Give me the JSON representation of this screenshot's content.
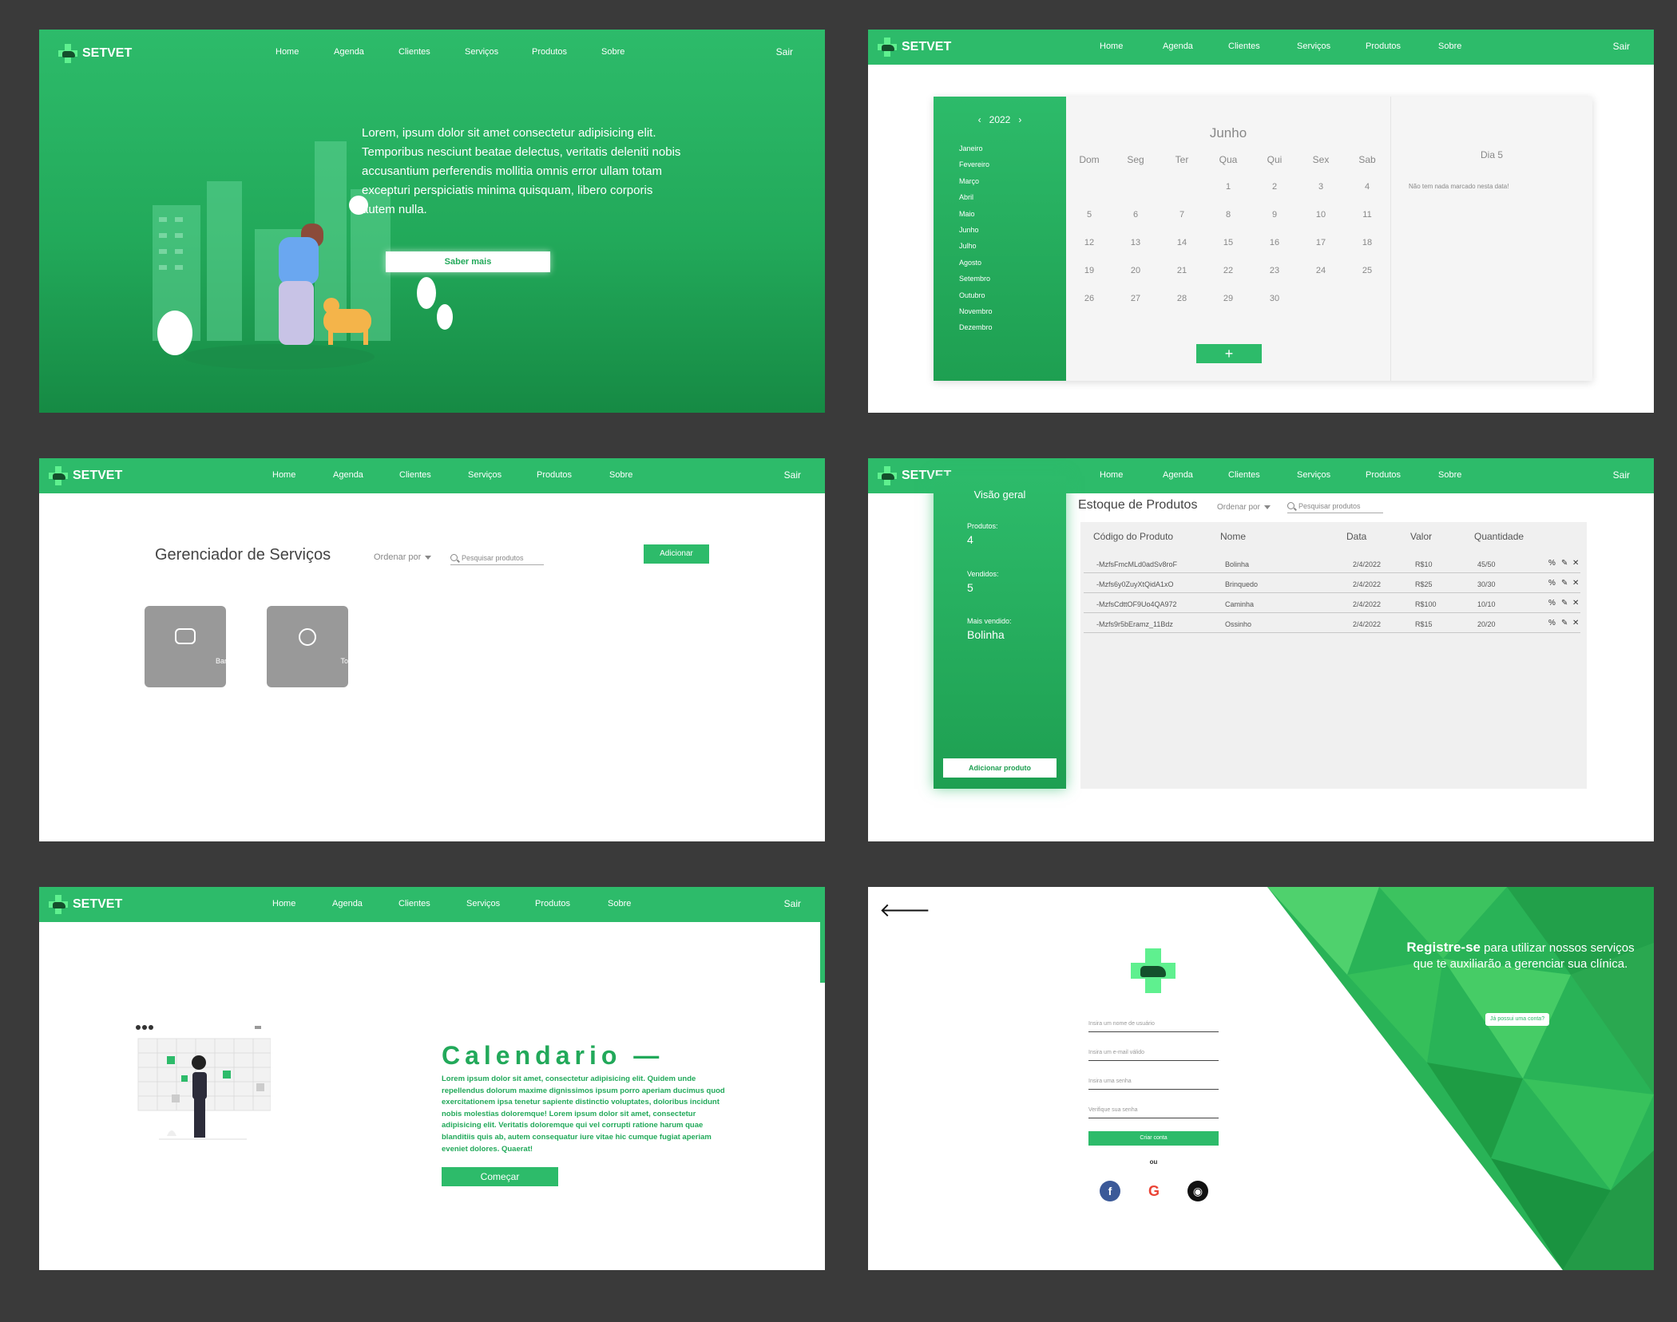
{
  "nav": {
    "brand": "SETVET",
    "links": [
      "Home",
      "Agenda",
      "Clientes",
      "Serviços",
      "Produtos",
      "Sobre"
    ],
    "logout": "Sair"
  },
  "home": {
    "hero_text": "Lorem, ipsum dolor sit amet consectetur adipisicing elit. Temporibus nesciunt beatae delectus, veritatis deleniti nobis accusantium perferendis mollitia omnis error ullam totam excepturi perspiciatis minima quisquam, libero corporis autem nulla.",
    "cta": "Saber mais"
  },
  "agenda": {
    "year": "2022",
    "months": [
      "Janeiro",
      "Fevereiro",
      "Março",
      "Abril",
      "Maio",
      "Junho",
      "Julho",
      "Agosto",
      "Setembro",
      "Outubro",
      "Novembro",
      "Dezembro"
    ],
    "current_month": "Junho",
    "weekdays": [
      "Dom",
      "Seg",
      "Ter",
      "Qua",
      "Qui",
      "Sex",
      "Sab"
    ],
    "days": [
      "",
      "",
      "",
      "1",
      "2",
      "3",
      "4",
      "5",
      "6",
      "7",
      "8",
      "9",
      "10",
      "11",
      "12",
      "13",
      "14",
      "15",
      "16",
      "17",
      "18",
      "19",
      "20",
      "21",
      "22",
      "23",
      "24",
      "25",
      "26",
      "27",
      "28",
      "29",
      "30"
    ],
    "add_label": "+",
    "selected_day": "Dia 5",
    "empty_message": "Não tem nada marcado nesta data!"
  },
  "services": {
    "title": "Gerenciador de Serviços",
    "sort_label": "Ordenar por",
    "search_placeholder": "Pesquisar produtos",
    "add_label": "Adicionar",
    "cards": [
      {
        "label": "Banho"
      },
      {
        "label": "Tosa"
      }
    ]
  },
  "products": {
    "overview_title": "Visão geral",
    "stats": [
      {
        "label": "Produtos:",
        "value": "4"
      },
      {
        "label": "Vendidos:",
        "value": "5"
      },
      {
        "label": "Mais vendido:",
        "value": "Bolinha"
      }
    ],
    "add_product": "Adicionar produto",
    "title": "Estoque de Produtos",
    "sort_label": "Ordenar por",
    "search_placeholder": "Pesquisar produtos",
    "columns": [
      "Código do Produto",
      "Nome",
      "Data",
      "Valor",
      "Quantidade"
    ],
    "rows": [
      {
        "code": "-MzfsFmcMLd0adSv8roF",
        "name": "Bolinha",
        "date": "2/4/2022",
        "price": "R$10",
        "qty": "45/50"
      },
      {
        "code": "-Mzfs6y0ZuyXtQidA1xO",
        "name": "Brinquedo",
        "date": "2/4/2022",
        "price": "R$25",
        "qty": "30/30"
      },
      {
        "code": "-MzfsCdttOF9Uo4QA972",
        "name": "Caminha",
        "date": "2/4/2022",
        "price": "R$100",
        "qty": "10/10"
      },
      {
        "code": "-Mzfs9r5bEramz_11Bdz",
        "name": "Ossinho",
        "date": "2/4/2022",
        "price": "R$15",
        "qty": "20/20"
      }
    ]
  },
  "calendar_intro": {
    "heading": "Calendario —",
    "body": "Lorem ipsum dolor sit amet, consectetur adipisicing elit. Quidem unde repellendus dolorum maxime dignissimos ipsum porro aperiam ducimus quod exercitationem ipsa tenetur sapiente distinctio voluptates, doloribus incidunt nobis molestias doloremque! Lorem ipsum dolor sit amet, consectetur adipisicing elit. Veritatis doloremque qui vel corrupti ratione harum quae blanditiis quis ab, autem consequatur iure vitae hic cumque fugiat aperiam eveniet dolores. Quaerat!",
    "cta": "Começar"
  },
  "register": {
    "headline_bold": "Registre-se",
    "headline_rest": " para utilizar nossos serviços que te auxiliarão a gerenciar sua clínica.",
    "have_account": "Já possui uma conta?",
    "fields": [
      {
        "placeholder": "Insira um nome de usuário"
      },
      {
        "placeholder": "Insira um e-mail válido"
      },
      {
        "placeholder": "Insira uma senha"
      },
      {
        "placeholder": "Verifique sua senha"
      }
    ],
    "submit": "Criar conta",
    "or": "ou",
    "social": [
      {
        "name": "facebook-icon",
        "glyph": "f",
        "color": "#3b5998"
      },
      {
        "name": "google-icon",
        "glyph": "G",
        "color": "#ffffff"
      },
      {
        "name": "github-icon",
        "glyph": "◉",
        "color": "#111111"
      }
    ]
  },
  "colors": {
    "primary": "#2dbb6a",
    "dark": "#168a44",
    "accent": "#5ff08f"
  }
}
